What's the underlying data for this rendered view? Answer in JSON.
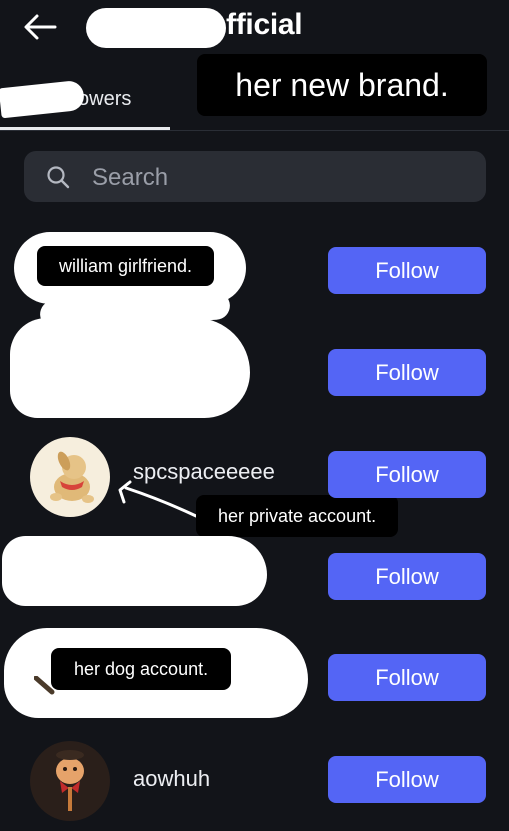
{
  "header": {
    "title": "official",
    "annotation": "her new brand."
  },
  "tabs": {
    "followers_label": "owers"
  },
  "search": {
    "placeholder": "Search"
  },
  "followers": [
    {
      "username": "",
      "annotation": "william girlfriend.",
      "button_label": "Follow"
    },
    {
      "username": "",
      "annotation": "",
      "button_label": "Follow"
    },
    {
      "username": "spcspaceeeee",
      "annotation": "her private account.",
      "button_label": "Follow"
    },
    {
      "username": "",
      "annotation": "",
      "button_label": "Follow"
    },
    {
      "username": "",
      "annotation": "her dog account.",
      "button_label": "Follow"
    },
    {
      "username": "aowhuh",
      "annotation": "",
      "button_label": "Follow"
    }
  ],
  "colors": {
    "background": "#121419",
    "follow_button": "#5465f5",
    "search_background": "#2a2d34"
  }
}
